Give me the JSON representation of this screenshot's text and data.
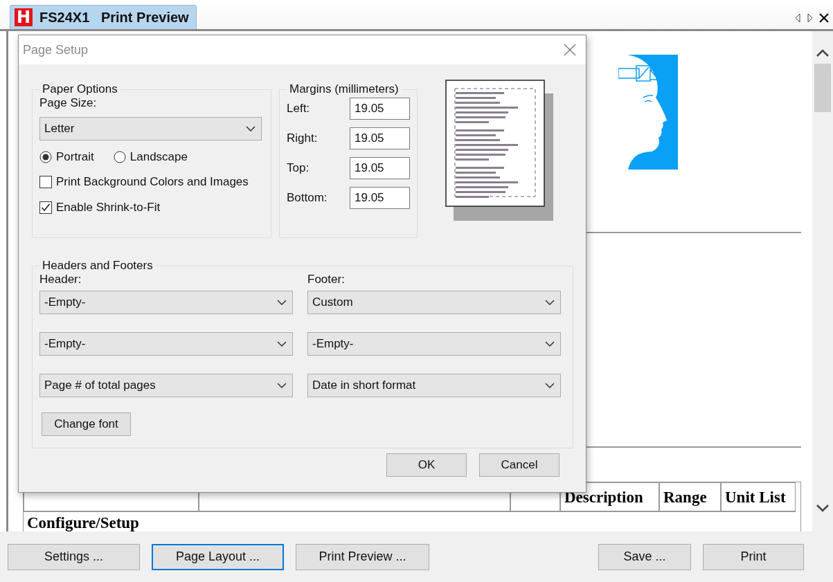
{
  "tab": {
    "logo_letter": "H",
    "title": "FS24X1   Print Preview"
  },
  "document": {
    "table": {
      "columns": [
        "Description",
        "Range",
        "Unit List"
      ],
      "rows": [
        [
          "Configure/Setup"
        ]
      ]
    }
  },
  "dialog": {
    "title": "Page Setup",
    "paper_options": {
      "legend": "Paper Options",
      "page_size_label": "Page Size:",
      "page_size": "Letter",
      "orientations": [
        {
          "label": "Portrait",
          "selected": true
        },
        {
          "label": "Landscape",
          "selected": false
        }
      ],
      "checkboxes": [
        {
          "label": "Print Background Colors and Images",
          "checked": false
        },
        {
          "label": "Enable Shrink-to-Fit",
          "checked": true
        }
      ]
    },
    "margins": {
      "legend": "Margins (millimeters)",
      "fields": [
        {
          "label": "Left:",
          "value": "19.05"
        },
        {
          "label": "Right:",
          "value": "19.05"
        },
        {
          "label": "Top:",
          "value": "19.05"
        },
        {
          "label": "Bottom:",
          "value": "19.05"
        }
      ]
    },
    "headers_footers": {
      "legend": "Headers and Footers",
      "header_label": "Header:",
      "footer_label": "Footer:",
      "header": [
        "-Empty-",
        "-Empty-",
        "Page # of total pages"
      ],
      "footer": [
        "Custom",
        "-Empty-",
        "Date in short format"
      ],
      "change_font": "Change font"
    },
    "buttons": [
      "OK",
      "Cancel"
    ]
  },
  "bottom_buttons": [
    {
      "label": "Settings ...",
      "focused": false
    },
    {
      "label": "Page Layout ...",
      "focused": true
    },
    {
      "label": "Print Preview ...",
      "focused": false
    },
    {
      "label": "Save ...",
      "focused": false
    },
    {
      "label": "Print",
      "focused": false
    }
  ]
}
